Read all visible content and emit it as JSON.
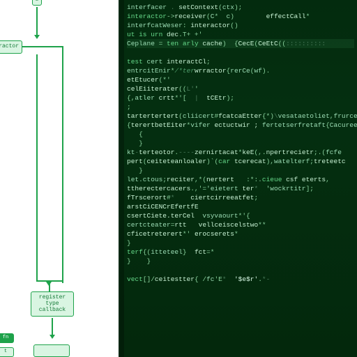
{
  "flowchart": {
    "top_stub": "E",
    "side_node": "interactor",
    "bottom_node_line1": "register",
    "bottom_node_line2": "type",
    "bottom_node_line3": "callback",
    "tiny_left": "fn",
    "tiny_left2": "t"
  },
  "code": {
    "lines": [
      {
        "cls": "",
        "segs": [
          [
            "tok-id",
            "interfacer"
          ],
          [
            "tok-dim",
            " . "
          ],
          [
            "tok-fn",
            "setContext"
          ],
          [
            "tok-punc",
            "("
          ],
          [
            "tok-id",
            "ctx"
          ],
          [
            "tok-punc",
            ");"
          ]
        ]
      },
      {
        "cls": "",
        "segs": [
          [
            "tok-kw",
            "interactor"
          ],
          [
            "tok-punc",
            "->"
          ],
          [
            "tok-fn",
            "receiver"
          ],
          [
            "tok-punc",
            "("
          ],
          [
            "tok-id",
            "C"
          ],
          [
            "tok-punc",
            "*  "
          ],
          [
            "tok-id",
            "c"
          ],
          [
            "tok-punc",
            ")"
          ],
          [
            "tok-dim",
            "        "
          ],
          [
            "tok-fn",
            "effectCall"
          ],
          [
            "tok-punc",
            "*"
          ]
        ]
      },
      {
        "cls": "",
        "segs": [
          [
            "tok-id",
            "interfcatWeser"
          ],
          [
            "tok-punc",
            ": "
          ],
          [
            "tok-fn",
            "interactor"
          ],
          [
            "tok-punc",
            "()"
          ]
        ]
      },
      {
        "cls": "",
        "segs": [
          [
            "tok-kw",
            "ut is urn "
          ],
          [
            "tok-fn",
            "dec"
          ],
          [
            "tok-punc",
            ".T+ +'"
          ]
        ]
      },
      {
        "cls": "highlight-line",
        "segs": [
          [
            "tok-id",
            "Ceplane"
          ],
          [
            "tok-punc",
            " = "
          ],
          [
            "tok-kw",
            "ten arly "
          ],
          [
            "tok-fn",
            "cache"
          ],
          [
            "tok-punc",
            ")  {"
          ],
          [
            "tok-fn",
            "CecE"
          ],
          [
            "tok-punc",
            "("
          ],
          [
            "tok-fn",
            "CeEtC"
          ],
          [
            "tok-punc",
            "(("
          ],
          [
            "tok-dim",
            "::::::::::"
          ]
        ]
      },
      {
        "cls": "",
        "segs": [
          [
            "tok-punc",
            " "
          ]
        ]
      },
      {
        "cls": "",
        "segs": [
          [
            "tok-kw",
            "test "
          ],
          [
            "tok-id",
            "cert "
          ],
          [
            "tok-fn",
            "interactCl"
          ],
          [
            "tok-punc",
            ";"
          ]
        ]
      },
      {
        "cls": "",
        "segs": [
          [
            "tok-id",
            "entrcitEnir"
          ],
          [
            "tok-punc",
            "*"
          ],
          [
            "tok-comment",
            "/*ter"
          ],
          [
            "tok-fn",
            "wrractor"
          ],
          [
            "tok-punc",
            "{"
          ],
          [
            "tok-id",
            "rerCe"
          ],
          [
            "tok-punc",
            "("
          ],
          [
            "tok-id",
            "wf"
          ],
          [
            "tok-punc",
            ")."
          ]
        ]
      },
      {
        "cls": "",
        "segs": [
          [
            "tok-fn",
            "etEtucer"
          ],
          [
            "tok-punc",
            "(*'"
          ]
        ]
      },
      {
        "cls": "",
        "segs": [
          [
            "tok-fn",
            "celEiiterater"
          ],
          [
            "tok-punc",
            "(("
          ],
          [
            "tok-dim",
            "L'"
          ],
          [
            "tok-punc",
            "' "
          ]
        ]
      },
      {
        "cls": "",
        "segs": [
          [
            "tok-punc",
            "{,"
          ],
          [
            "tok-id",
            "atler "
          ],
          [
            "tok-fn",
            "crtt"
          ],
          [
            "tok-punc",
            "*'["
          ],
          [
            "tok-dim",
            "  |  "
          ],
          [
            "tok-fn",
            "tCEtr"
          ],
          [
            "tok-punc",
            ");"
          ]
        ]
      },
      {
        "cls": "",
        "segs": [
          [
            "tok-punc",
            ";"
          ]
        ]
      },
      {
        "cls": "",
        "segs": [
          [
            "tok-fn",
            "tartertertert"
          ],
          [
            "tok-punc",
            "("
          ],
          [
            "tok-id",
            "cliicert"
          ],
          [
            "tok-punc",
            "#"
          ],
          [
            "tok-fn",
            "fcatcaEtter"
          ],
          [
            "tok-punc",
            "{*)"
          ],
          [
            "tok-dim",
            "\\"
          ],
          [
            "tok-id",
            "vesataetoliet"
          ],
          [
            "tok-punc",
            ","
          ],
          [
            "tok-id",
            "frurcetc"
          ]
        ]
      },
      {
        "cls": "",
        "segs": [
          [
            "tok-punc",
            "{"
          ],
          [
            "tok-fn",
            "terertbetEiter"
          ],
          [
            "tok-punc",
            "*"
          ],
          [
            "tok-id",
            "vifer "
          ],
          [
            "tok-fn",
            "ectuctwir ;"
          ],
          [
            "tok-id",
            " fertetserfretaft"
          ],
          [
            "tok-punc",
            "{"
          ],
          [
            "tok-id",
            "Cacureef"
          ]
        ]
      },
      {
        "cls": "",
        "segs": [
          [
            "tok-punc",
            "   {"
          ]
        ]
      },
      {
        "cls": "",
        "segs": [
          [
            "tok-punc",
            "   }"
          ]
        ]
      },
      {
        "cls": "",
        "segs": [
          [
            "tok-id",
            "kt"
          ],
          [
            "tok-dim",
            "-"
          ],
          [
            "tok-fn",
            "terteotor"
          ],
          [
            "tok-punc",
            "."
          ],
          [
            "tok-dim",
            "----"
          ],
          [
            "tok-fn",
            "zernirtacat"
          ],
          [
            "tok-punc",
            "*"
          ],
          [
            "tok-fn",
            "keE"
          ],
          [
            "tok-punc",
            "(,."
          ],
          [
            "tok-fn",
            "npertrecietr"
          ],
          [
            "tok-punc",
            ";.("
          ],
          [
            "tok-id",
            "fcfe"
          ]
        ]
      },
      {
        "cls": "",
        "segs": [
          [
            "tok-fn",
            "pert"
          ],
          [
            "tok-punc",
            "("
          ],
          [
            "tok-fn",
            "ceiteteanloaler"
          ],
          [
            "tok-punc",
            ")`"
          ],
          [
            "tok-punc",
            "("
          ],
          [
            "tok-kw",
            "car "
          ],
          [
            "tok-fn",
            "tcerecat"
          ],
          [
            "tok-punc",
            "),"
          ],
          [
            "tok-id",
            "watelterf"
          ],
          [
            "tok-punc",
            ";"
          ],
          [
            "tok-fn",
            "treteetc"
          ]
        ]
      },
      {
        "cls": "",
        "segs": [
          [
            "tok-punc",
            "   }"
          ]
        ]
      },
      {
        "cls": "",
        "segs": [
          [
            "tok-id",
            "let.ctous"
          ],
          [
            "tok-punc",
            ";"
          ],
          [
            "tok-fn",
            "reciter"
          ],
          [
            "tok-punc",
            ",*("
          ],
          [
            "tok-fn",
            "nertert"
          ],
          [
            "tok-punc",
            "   :*:."
          ],
          [
            "tok-kw",
            "cieue "
          ],
          [
            "tok-fn",
            "csf eterts"
          ],
          [
            "tok-punc",
            ","
          ]
        ]
      },
      {
        "cls": "",
        "segs": [
          [
            "tok-fn",
            "ttherectercacers"
          ],
          [
            "tok-punc",
            ".,'="
          ],
          [
            "tok-id",
            "'eietert "
          ],
          [
            "tok-fn",
            "ter"
          ],
          [
            "tok-dim",
            "*  "
          ],
          [
            "tok-id",
            "'wockrtitr"
          ],
          [
            "tok-punc",
            "];"
          ]
        ]
      },
      {
        "cls": "",
        "segs": [
          [
            "tok-fn",
            "fTrscerort"
          ],
          [
            "tok-punc",
            "#"
          ],
          [
            "tok-dim",
            "*    "
          ],
          [
            "tok-fn",
            "ciertcirreeatfet"
          ],
          [
            "tok-punc",
            ";"
          ]
        ]
      },
      {
        "cls": "",
        "segs": [
          [
            "tok-fn",
            "arstCiCENCrEfertfE"
          ],
          [
            "tok-punc",
            "   "
          ]
        ]
      },
      {
        "cls": "",
        "segs": [
          [
            "tok-fn",
            "csertCiete.terCel"
          ],
          [
            "tok-punc",
            "  "
          ],
          [
            "tok-id",
            "vsyvaourt"
          ],
          [
            "tok-punc",
            "*'{"
          ]
        ]
      },
      {
        "cls": "",
        "segs": [
          [
            "tok-id",
            "certcteater"
          ],
          [
            "tok-punc",
            "="
          ],
          [
            "tok-fn",
            "rtt"
          ],
          [
            "tok-punc",
            "   "
          ],
          [
            "tok-fn",
            "vellceiscelstwo"
          ],
          [
            "tok-punc",
            "**"
          ]
        ]
      },
      {
        "cls": "",
        "segs": [
          [
            "tok-fn",
            "cficetreterert"
          ],
          [
            "tok-punc",
            "*' "
          ],
          [
            "tok-fn",
            "erocserets"
          ],
          [
            "tok-punc",
            "*"
          ],
          [
            "tok-lit",
            ""
          ],
          [
            "tok-punc",
            "  "
          ]
        ]
      },
      {
        "cls": "",
        "segs": [
          [
            "tok-punc",
            "}"
          ]
        ]
      },
      {
        "cls": "",
        "segs": [
          [
            "tok-kw",
            "terf"
          ],
          [
            "tok-punc",
            "{("
          ],
          [
            "tok-id",
            "itteteel"
          ],
          [
            "tok-punc",
            "}"
          ],
          [
            "tok-dim",
            "  "
          ],
          [
            "tok-fn",
            "fct"
          ],
          [
            "tok-punc",
            "=*"
          ]
        ]
      },
      {
        "cls": "",
        "segs": [
          [
            "tok-punc",
            "}    }"
          ]
        ]
      },
      {
        "cls": "",
        "segs": [
          [
            "tok-punc",
            " "
          ]
        ]
      },
      {
        "cls": "",
        "segs": [
          [
            "tok-kw",
            "vect"
          ],
          [
            "tok-punc",
            "[]/"
          ],
          [
            "tok-fn",
            "ceitestter"
          ],
          [
            "tok-punc",
            "{ /"
          ],
          [
            "tok-id",
            "fc"
          ],
          [
            "tok-punc",
            "'E"
          ],
          [
            "tok-dim",
            "*  "
          ],
          [
            "tok-lit",
            "'$e$r'"
          ],
          [
            "tok-punc",
            "."
          ],
          [
            "tok-dim",
            "*-"
          ]
        ]
      }
    ]
  },
  "colors": {
    "accent": "#1ea24a",
    "editor_bg": "#032b0e",
    "editor_fg": "#cfeee0"
  }
}
